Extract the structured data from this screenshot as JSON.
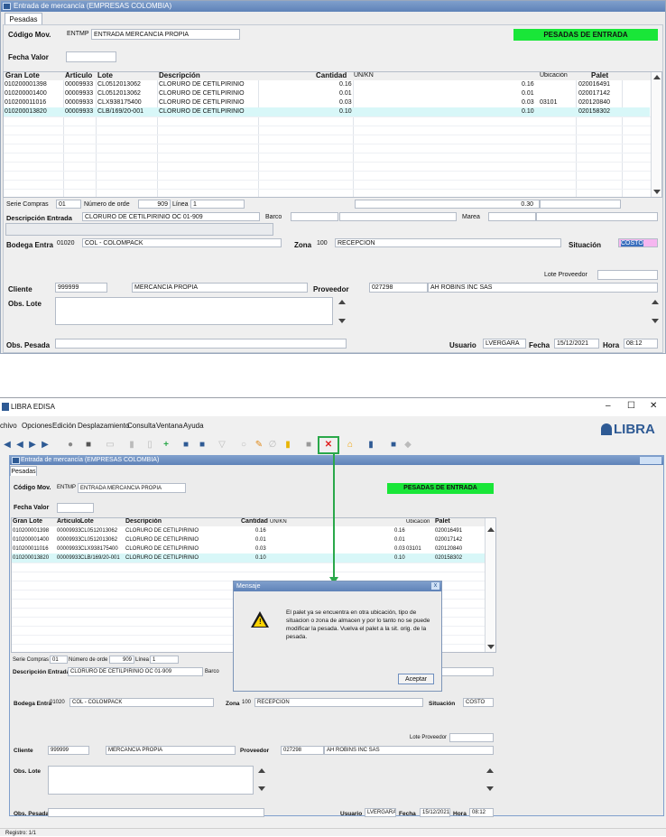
{
  "window": {
    "title": "Entrada de mercancía (EMPRESAS COLOMBIA)",
    "tab": "Pesadas"
  },
  "labels": {
    "codigo_mov": "Código Mov.",
    "fecha_valor": "Fecha Valor",
    "badge": "PESADAS DE ENTRADA",
    "serie_compras": "Serie Compras",
    "numero_orden": "Número de orde",
    "linea": "Línea",
    "descripcion_entrada": "Descripción Entrada",
    "barco": "Barco",
    "marea": "Marea",
    "bodega_entra": "Bodega Entra",
    "zona": "Zona",
    "situacion": "Situación",
    "lote_proveedor": "Lote Proveedor",
    "cliente": "Cliente",
    "proveedor": "Proveedor",
    "obs_lote": "Obs. Lote",
    "obs_pesada": "Obs. Pesada",
    "usuario": "Usuario",
    "fecha": "Fecha",
    "hora": "Hora"
  },
  "values": {
    "codigo_mov": "ENTMP",
    "codigo_mov_desc": "ENTRADA MERCANCIA PROPIA",
    "serie_compras": "01",
    "numero_orden": "909",
    "linea": "1",
    "total": "0.30",
    "descripcion_entrada": "CLORURO DE CETILPIRINIO OC 01-909",
    "bodega": "01020",
    "bodega_desc": "COL - COLOMPACK",
    "zona": "100",
    "zona_desc": "RECEPCION",
    "situacion": "COSTO",
    "cliente": "999999",
    "cliente_desc": "MERCANCIA PROPIA",
    "proveedor": "027298",
    "proveedor_desc": "AH ROBINS INC SAS",
    "usuario": "LVERGARA",
    "fecha": "15/12/2021",
    "hora": "08:12"
  },
  "columns": {
    "gran_lote": "Gran Lote",
    "articulo": "Articulo",
    "lote": "Lote",
    "descripcion": "Descripción",
    "cantidad": "Cantidad",
    "unkn": "UN/KN",
    "ubicacion": "Ubicación",
    "palet": "Palet"
  },
  "rows": [
    {
      "gran_lote": "010200001398",
      "articulo": "00009933",
      "lote": "CL0512013062",
      "descripcion": "CLORURO DE CETILPIRINIO",
      "cantidad": "0.16",
      "unkn_val": "0.16",
      "ubicacion": "",
      "palet": "020016491"
    },
    {
      "gran_lote": "010200001400",
      "articulo": "00009933",
      "lote": "CL0512013062",
      "descripcion": "CLORURO DE CETILPIRINIO",
      "cantidad": "0.01",
      "unkn_val": "0.01",
      "ubicacion": "",
      "palet": "020017142"
    },
    {
      "gran_lote": "010200011016",
      "articulo": "00009933",
      "lote": "CLX938175400",
      "descripcion": "CLORURO DE CETILPIRINIO",
      "cantidad": "0.03",
      "unkn_val": "0.03",
      "ubicacion": "03101",
      "palet": "020120840"
    },
    {
      "gran_lote": "010200013820",
      "articulo": "00009933",
      "lote": "CLB/169/20-001",
      "descripcion": "CLORURO DE CETILPIRINIO",
      "cantidad": "0.10",
      "unkn_val": "0.10",
      "ubicacion": "",
      "palet": "020158302"
    }
  ],
  "app": {
    "title": "LIBRA EDISA",
    "logo": "LIBRA",
    "controls": {
      "minimize": "–",
      "maximize": "☐",
      "close": "✕"
    }
  },
  "menu": [
    "chivo",
    "Opciones",
    "Edición",
    "Desplazamiento",
    "Consulta",
    "Ventana",
    "Ayuda"
  ],
  "dialog": {
    "title": "Mensaje",
    "message": "El palet ya se encuentra en otra ubicación, tipo de situacion o zona de almacen y por lo tanto no se puede modificar la pesada. Vuelva el palet a la sit. orig. de la pesada.",
    "button": "Aceptar",
    "close": "x"
  },
  "status": {
    "registro": "Registro: 1/1"
  },
  "colors": {
    "badge": "#19e638",
    "highlight": "#d8f7f8",
    "situacion_top": "#f6b6f0",
    "arrow": "#2aa84a",
    "title": "#5e82b8"
  }
}
